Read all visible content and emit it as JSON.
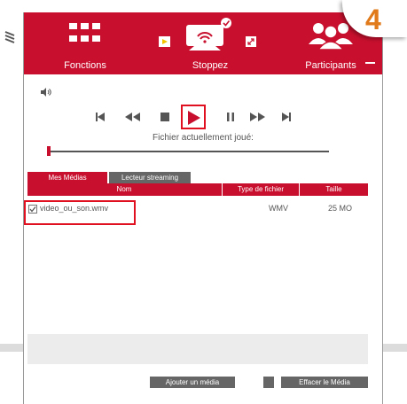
{
  "step_badge": "4",
  "header": {
    "fonctions_label": "Fonctions",
    "stop_label": "Stoppez",
    "participants_label": "Participants"
  },
  "player": {
    "current_file_caption": "Fichier actuellement joué:",
    "position": 0.0
  },
  "tabs": [
    {
      "label": "Mes Médias",
      "active": true
    },
    {
      "label": "Lecteur streaming",
      "active": false
    }
  ],
  "table": {
    "columns": [
      "Nom",
      "Type de fichier",
      "Taille"
    ],
    "rows": [
      {
        "checked": true,
        "name": "video_ou_son.wmv",
        "type": "WMV",
        "size": "25 MO"
      }
    ]
  },
  "buttons": {
    "add": "Ajouter un média",
    "delete": "Effacer le Média"
  },
  "colors": {
    "accent": "#c8102e",
    "badge": "#e07a1a",
    "highlight": "#e01020"
  },
  "icons": [
    "logo-icon",
    "grid-icon",
    "play-small-icon",
    "screen-share-icon",
    "check-badge-icon",
    "expand-icon",
    "group-icon",
    "volume-icon",
    "skip-back-icon",
    "rewind-icon",
    "stop-icon",
    "play-icon",
    "pause-icon",
    "fast-forward-icon",
    "skip-forward-icon",
    "checkbox-icon"
  ]
}
